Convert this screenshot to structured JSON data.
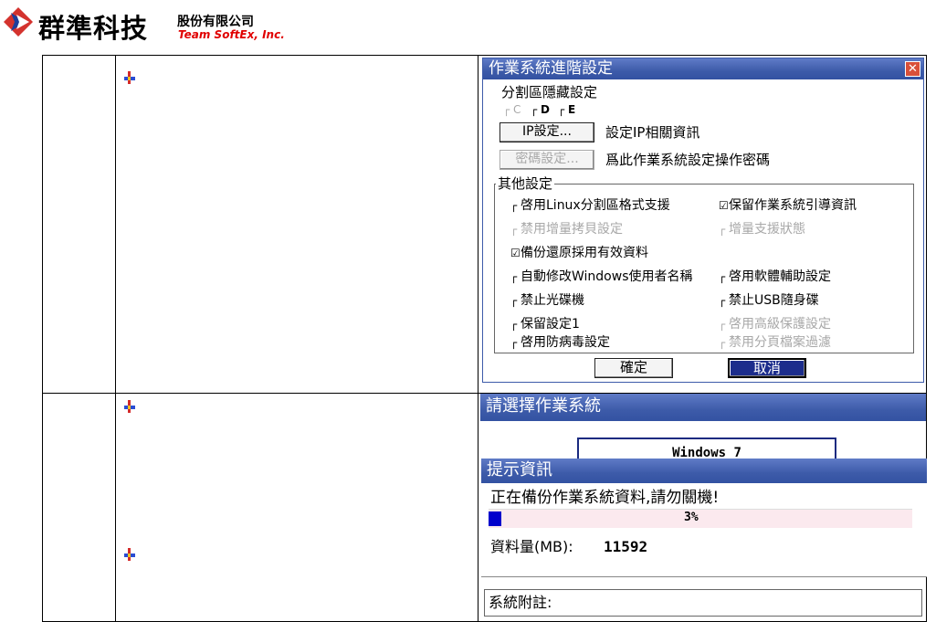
{
  "header": {
    "company_name": "群準科技",
    "company_suffix": "股份有限公司",
    "company_english": "Team SoftEx, Inc."
  },
  "colors": {
    "titlebar": "#3d5ba9",
    "progress_fill": "#0000cc",
    "progress_track": "#fbe9ee",
    "brand_red": "#e00000"
  },
  "advanced_dialog": {
    "title": "作業系統進階設定",
    "partition_hide_label": "分割區隱藏設定",
    "partitions": [
      {
        "label": "C",
        "checked": false,
        "disabled": true
      },
      {
        "label": "D",
        "checked": false,
        "disabled": false
      },
      {
        "label": "E",
        "checked": false,
        "disabled": false
      }
    ],
    "ip_button": "IP設定...",
    "ip_desc": "設定IP相關資訊",
    "password_button": "密碼設定...",
    "password_desc": "爲此作業系統設定操作密碼",
    "other_settings_label": "其他設定",
    "options": [
      {
        "label": "啓用Linux分割區格式支援",
        "checked": false,
        "disabled": false
      },
      {
        "label": "保留作業系統引導資訊",
        "checked": true,
        "disabled": false
      },
      {
        "label": "禁用增量拷貝設定",
        "checked": false,
        "disabled": true
      },
      {
        "label": "增量支援狀態",
        "checked": false,
        "disabled": true
      },
      {
        "label": "備份還原採用有效資料",
        "checked": true,
        "disabled": false
      },
      {
        "label": "自動修改Windows使用者名稱",
        "checked": false,
        "disabled": false
      },
      {
        "label": "啓用軟體輔助設定",
        "checked": false,
        "disabled": false
      },
      {
        "label": "禁止光碟機",
        "checked": false,
        "disabled": false
      },
      {
        "label": "禁止USB隨身碟",
        "checked": false,
        "disabled": false
      },
      {
        "label": "保留設定1",
        "checked": false,
        "disabled": false
      },
      {
        "label": "啓用高級保護設定",
        "checked": false,
        "disabled": true
      },
      {
        "label": "啓用防病毒設定",
        "checked": false,
        "disabled": false
      },
      {
        "label": "禁用分頁檔案過濾",
        "checked": false,
        "disabled": true
      }
    ],
    "ok_button": "確定",
    "cancel_button": "取消"
  },
  "os_select": {
    "title": "請選擇作業系統",
    "os_item": "Windows 7",
    "notes_label": "系統附註:"
  },
  "progress_dialog": {
    "title": "提示資訊",
    "message": "正在備份作業系統資料,請勿關機!",
    "percent": 3,
    "percent_label": "3%",
    "data_label": "資料量(MB):",
    "data_value": "11592"
  }
}
